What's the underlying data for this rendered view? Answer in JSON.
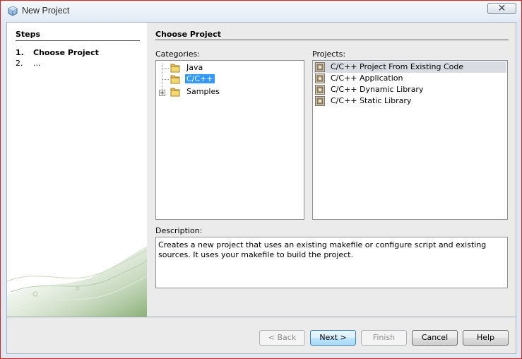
{
  "window": {
    "title": "New Project",
    "close_symbol": "✕"
  },
  "steps": {
    "title": "Steps",
    "items": [
      {
        "number": "1.",
        "label": "Choose Project"
      },
      {
        "number": "2.",
        "label": "..."
      }
    ]
  },
  "main": {
    "title": "Choose Project",
    "categories_label": "Categories:",
    "projects_label": "Projects:",
    "description_label": "Description:",
    "description_text": "Creates a new project that uses an existing makefile or configure script and existing sources. It uses your makefile to build the project."
  },
  "categories": [
    {
      "label": "Java",
      "icon": "folder-icon",
      "selected": false
    },
    {
      "label": "C/C++",
      "icon": "folder-icon",
      "selected": true
    },
    {
      "label": "Samples",
      "icon": "folder-icon",
      "selected": false,
      "expandable": true
    }
  ],
  "projects": [
    {
      "label": "C/C++ Project From Existing Code",
      "icon": "project-icon",
      "selected": true
    },
    {
      "label": "C/C++ Application",
      "icon": "project-icon",
      "selected": false
    },
    {
      "label": "C/C++ Dynamic Library",
      "icon": "project-icon",
      "selected": false
    },
    {
      "label": "C/C++ Static Library",
      "icon": "project-icon",
      "selected": false
    }
  ],
  "buttons": {
    "back": "< Back",
    "next": "Next >",
    "finish": "Finish",
    "cancel": "Cancel",
    "help": "Help"
  },
  "colors": {
    "selection": "#3399ff",
    "window_border": "#d02020"
  }
}
